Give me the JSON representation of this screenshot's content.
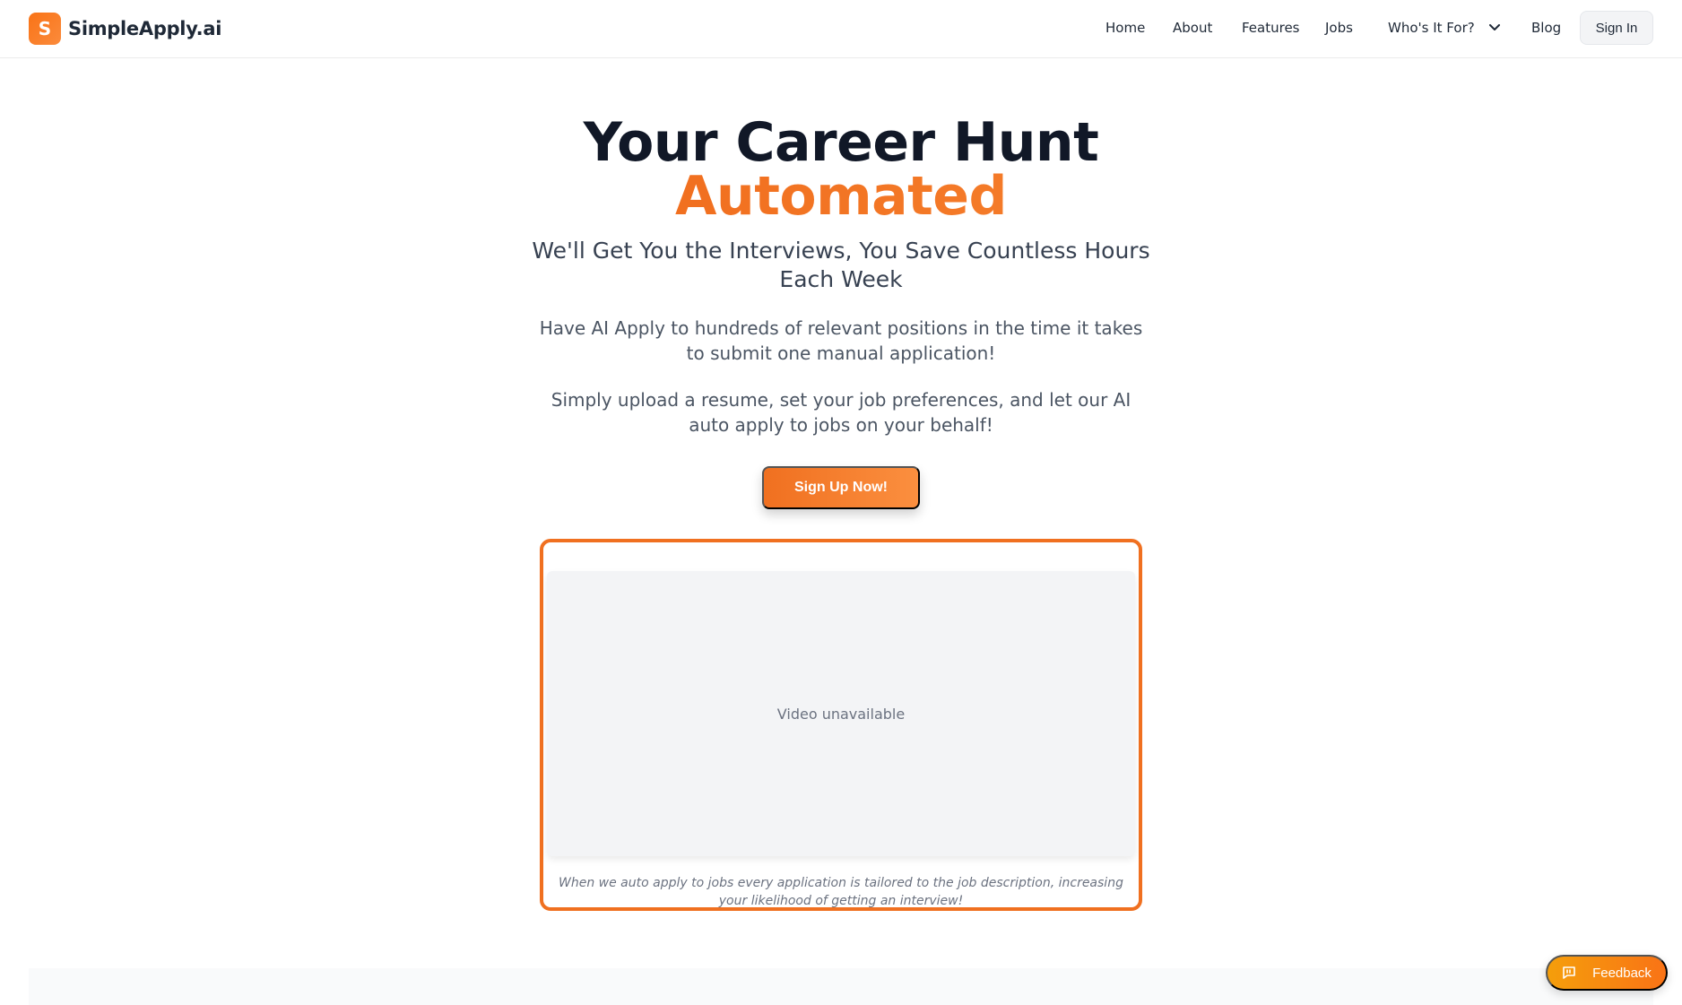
{
  "brand": {
    "logo_letter": "S",
    "name": "SimpleApply.ai"
  },
  "nav": {
    "home": "Home",
    "about": "About",
    "features": "Features",
    "jobs": "Jobs",
    "who": "Who's It For?",
    "blog": "Blog",
    "sign_in": "Sign In"
  },
  "hero": {
    "title_line1": "Your Career Hunt",
    "title_line2": "Automated",
    "subtitle": "We'll Get You the Interviews, You Save Countless Hours Each Week",
    "desc1": "Have AI Apply to hundreds of relevant positions in the time it takes to submit one manual application!",
    "desc2": "Simply upload a resume, set your job preferences, and let our AI auto apply to jobs on your behalf!",
    "cta": "Sign Up Now!"
  },
  "video": {
    "status": "Video unavailable",
    "caption": "When we auto apply to jobs every application is tailored to the job description, increasing your likelihood of getting an interview!"
  },
  "feedback": {
    "label": "Feedback"
  },
  "icons": {
    "dropdown": "chevron-down-icon",
    "feedback": "message-icon"
  },
  "colors": {
    "accent": "#f07020",
    "text": "#111827"
  }
}
